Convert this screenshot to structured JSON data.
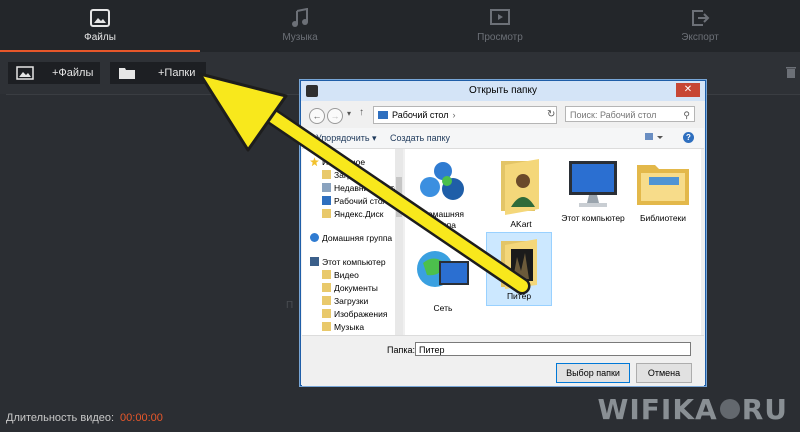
{
  "tabs": [
    {
      "label": "Файлы",
      "icon": "film-image-icon",
      "active": true
    },
    {
      "label": "Музыка",
      "icon": "music-note-icon",
      "active": false
    },
    {
      "label": "Просмотр",
      "icon": "play-screen-icon",
      "active": false
    },
    {
      "label": "Экспорт",
      "icon": "export-icon",
      "active": false
    }
  ],
  "toolbar": {
    "add_files": "+Файлы",
    "add_folders": "+Папки"
  },
  "workarea": {
    "hint": "П"
  },
  "footer": {
    "duration_label": "Длительность видео:",
    "duration_value": "00:00:00"
  },
  "watermark": {
    "left": "WIFIKA",
    "right": "RU"
  },
  "dialog": {
    "title": "Открыть папку",
    "close": "✕",
    "address": "Рабочий стол",
    "search_placeholder": "Поиск: Рабочий стол",
    "organize": "Упорядочить ▾",
    "new_folder": "Создать папку",
    "help": "?",
    "nav": [
      {
        "label": "Избранное",
        "icon": "star-icon"
      },
      {
        "label": "Загрузки",
        "icon": "download-folder-icon"
      },
      {
        "label": "Недавние места",
        "icon": "recent-places-icon"
      },
      {
        "label": "Рабочий стол",
        "icon": "desktop-icon"
      },
      {
        "label": "Яндекс.Диск",
        "icon": "folder-icon"
      },
      {
        "label": "Домашняя группа",
        "icon": "homegroup-icon"
      },
      {
        "label": "Этот компьютер",
        "icon": "computer-icon"
      },
      {
        "label": "Видео",
        "icon": "video-folder-icon"
      },
      {
        "label": "Документы",
        "icon": "documents-folder-icon"
      },
      {
        "label": "Загрузки",
        "icon": "download-folder-icon"
      },
      {
        "label": "Изображения",
        "icon": "pictures-folder-icon"
      },
      {
        "label": "Музыка",
        "icon": "music-folder-icon"
      }
    ],
    "items": [
      {
        "label": "Домашняя группа",
        "icon": "homegroup-icon"
      },
      {
        "label": "AKart",
        "icon": "user-folder-icon"
      },
      {
        "label": "Этот компьютер",
        "icon": "computer-icon"
      },
      {
        "label": "Библиотеки",
        "icon": "libraries-folder-icon"
      },
      {
        "label": "Сеть",
        "icon": "network-icon"
      },
      {
        "label": "Питер",
        "icon": "folder-icon",
        "selected": true
      }
    ],
    "folder_label": "Папка:",
    "folder_value": "Питер",
    "select_button": "Выбор папки",
    "cancel_button": "Отмена"
  },
  "colors": {
    "accent": "#e8572a",
    "background": "#2b2e33",
    "dialog_title": "#d4e4f7",
    "arrow": "#f8e81c"
  }
}
